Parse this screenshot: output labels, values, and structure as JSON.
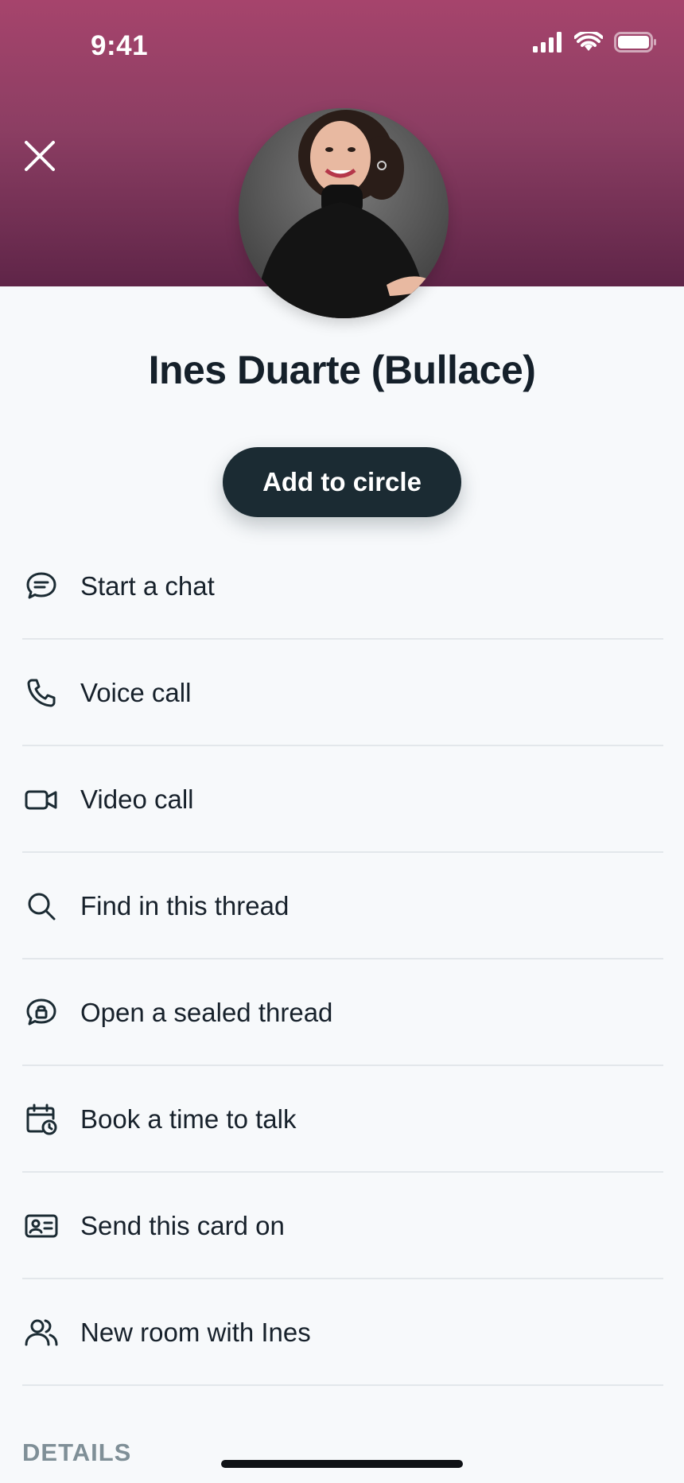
{
  "status_bar": {
    "time": "9:41"
  },
  "contact": {
    "name": "Ines Duarte (Bullace)",
    "avatar_description": "avatar-photo"
  },
  "primary_action": {
    "label": "Add to circle"
  },
  "actions": [
    {
      "label": "Start a chat",
      "icon": "chat-bubble-icon"
    },
    {
      "label": "Voice call",
      "icon": "phone-icon"
    },
    {
      "label": "Video call",
      "icon": "video-camera-icon"
    },
    {
      "label": "Find in this thread",
      "icon": "search-icon"
    },
    {
      "label": "Open a sealed thread",
      "icon": "lock-chat-icon"
    },
    {
      "label": "Book a time to talk",
      "icon": "calendar-clock-icon"
    },
    {
      "label": "Send this card on",
      "icon": "contact-card-icon"
    },
    {
      "label": "New room with Ines",
      "icon": "group-icon"
    }
  ],
  "sections": {
    "details": "DETAILS"
  },
  "colors": {
    "header_top": "#a6446c",
    "header_bottom": "#5f2548",
    "button_bg": "#1b2b33",
    "background": "#f7f9fb"
  }
}
